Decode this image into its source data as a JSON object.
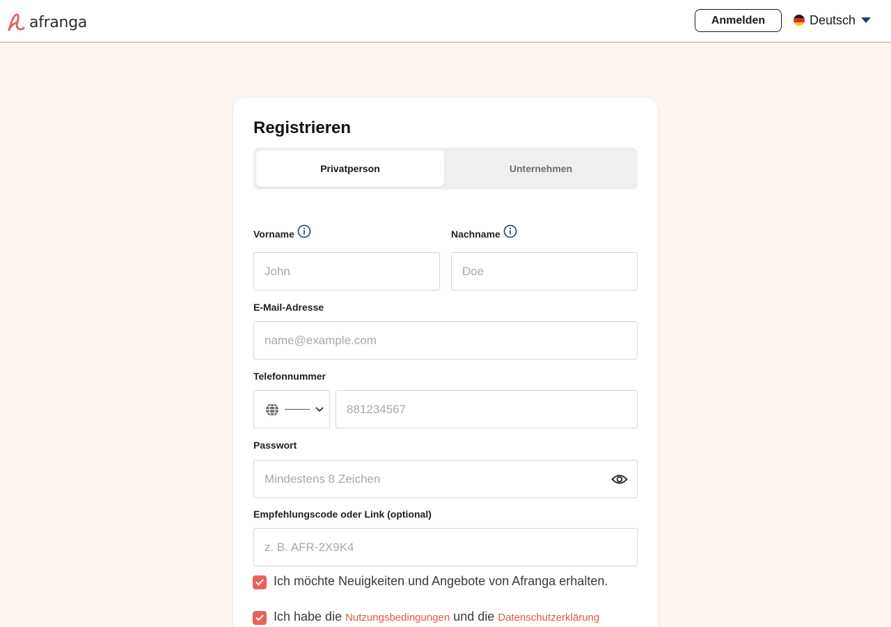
{
  "header": {
    "logo_text": "afranga",
    "login_label": "Anmelden",
    "language_label": "Deutsch",
    "brand_color": "#e8625a"
  },
  "form": {
    "title": "Registrieren",
    "tabs": [
      {
        "label": "Privatperson",
        "active": true
      },
      {
        "label": "Unternehmen",
        "active": false
      }
    ],
    "first_name": {
      "label": "Vorname",
      "placeholder": "John",
      "value": ""
    },
    "last_name": {
      "label": "Nachname",
      "placeholder": "Doe",
      "value": ""
    },
    "email": {
      "label": "E-Mail-Adresse",
      "placeholder": "name@example.com",
      "value": ""
    },
    "phone": {
      "label": "Telefonnummer",
      "placeholder": "881234567",
      "value": "",
      "country_icon": "globe-icon"
    },
    "password": {
      "label": "Passwort",
      "placeholder": "Mindestens 8 Zeichen",
      "value": ""
    },
    "referral": {
      "label": "Empfehlungscode oder Link (optional)",
      "placeholder": "z. B. AFR-2X9K4",
      "value": ""
    },
    "newsletter": {
      "checked": true,
      "text": "Ich möchte Neuigkeiten und Angebote von Afranga erhalten."
    },
    "terms": {
      "checked": true,
      "text_before": "Ich habe die",
      "terms_link": "Nutzungsbedingungen",
      "text_middle": "und die",
      "privacy_link": "Datenschutzerklärung"
    }
  }
}
